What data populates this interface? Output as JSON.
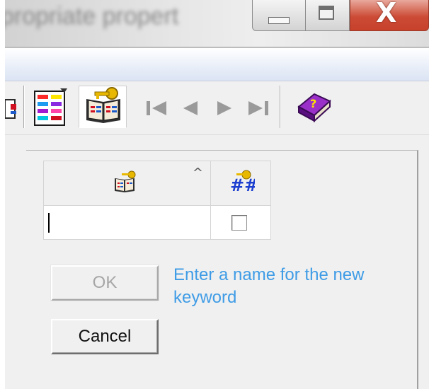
{
  "window": {
    "title": "propriate propert",
    "controls": {
      "minimize": "minimize",
      "maximize": "maximize",
      "close": "X"
    }
  },
  "toolbar": {
    "icons": [
      "partial-icon",
      "color-palette-icon",
      "keyword-book-icon",
      "first-record-icon",
      "previous-record-icon",
      "next-record-icon",
      "last-record-icon",
      "help-book-icon"
    ],
    "colors": {
      "help_book": "#7a1fa2",
      "palette": [
        "#ff2a2a",
        "#ffe600",
        "#1d9bf0",
        "#8a2be2",
        "#ff44aa",
        "#00c8e0",
        "#7a5cff",
        "#d01020"
      ]
    }
  },
  "grid": {
    "columns": [
      {
        "icon": "keyword-name-column-icon",
        "sort": "^"
      },
      {
        "icon": "keyword-id-column-icon"
      }
    ],
    "new_row": {
      "name": "",
      "checked": false
    }
  },
  "buttons": {
    "ok_label": "OK",
    "cancel_label": "Cancel"
  },
  "hint": "Enter a name for the new keyword",
  "colors": {
    "hint_text": "#3f9ce6",
    "close_button": "#c7412b"
  }
}
